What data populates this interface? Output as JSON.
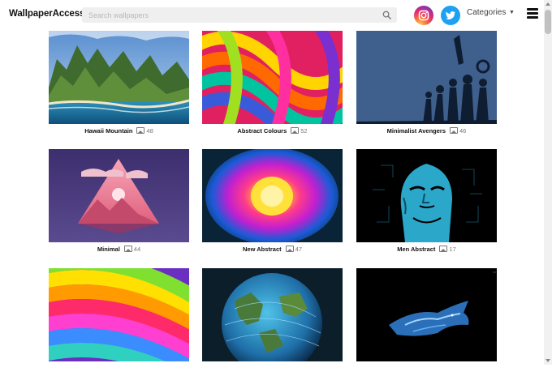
{
  "header": {
    "logo": "WallpaperAccess",
    "search_placeholder": "Search wallpapers",
    "search_icon": "search-icon",
    "categories_label": "Categories",
    "categories_caret": "▼",
    "social": [
      "instagram-icon",
      "twitter-icon"
    ],
    "menu_icon": "hamburger-menu-icon"
  },
  "gallery": {
    "items": [
      {
        "title": "Hawaii Mountain",
        "count": "48"
      },
      {
        "title": "Abstract Colours",
        "count": "52"
      },
      {
        "title": "Minimalist Avengers",
        "count": "46"
      },
      {
        "title": "Minimal",
        "count": "44"
      },
      {
        "title": "New Abstract",
        "count": "47"
      },
      {
        "title": "Men Abstract",
        "count": "17"
      },
      {
        "title": "",
        "count": ""
      },
      {
        "title": "",
        "count": ""
      },
      {
        "title": "",
        "count": ""
      }
    ]
  },
  "colors": {
    "instagram_gradient_mid": "#dd2a7b",
    "twitter": "#1da1f2",
    "search_bg": "#efefef"
  }
}
